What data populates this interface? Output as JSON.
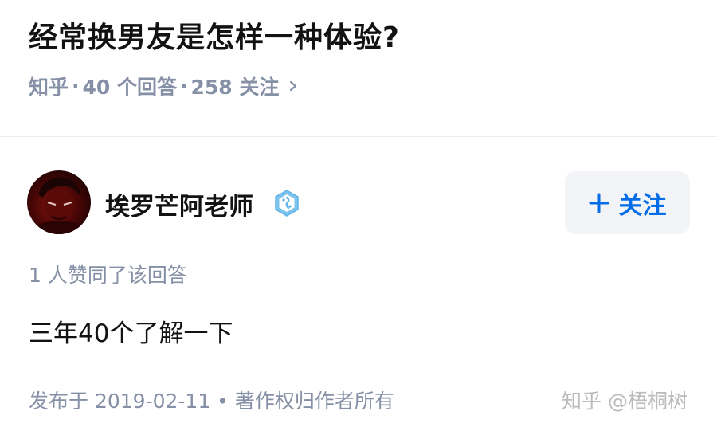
{
  "question": {
    "title": "经常换男友是怎样一种体验?",
    "source": "知乎",
    "answers": "40 个回答",
    "followers": "258 关注"
  },
  "author": {
    "name": "埃罗芒阿老师",
    "follow_label": "关注"
  },
  "answer": {
    "upvote_note": "1 人赞同了该回答",
    "content": "三年40个了解一下",
    "footer": "发布于 2019-02-11 • 著作权归作者所有"
  },
  "watermark": "知乎 @梧桐树",
  "colors": {
    "accent": "#056de8",
    "muted": "#8590a6",
    "text": "#121212",
    "button_bg": "#f2f4f7",
    "badge": "#5fb3e8"
  },
  "icons": {
    "meta_chevron": "chevron-right-icon",
    "verify_badge": "verified-badge-icon",
    "follow_plus": "plus-icon"
  }
}
